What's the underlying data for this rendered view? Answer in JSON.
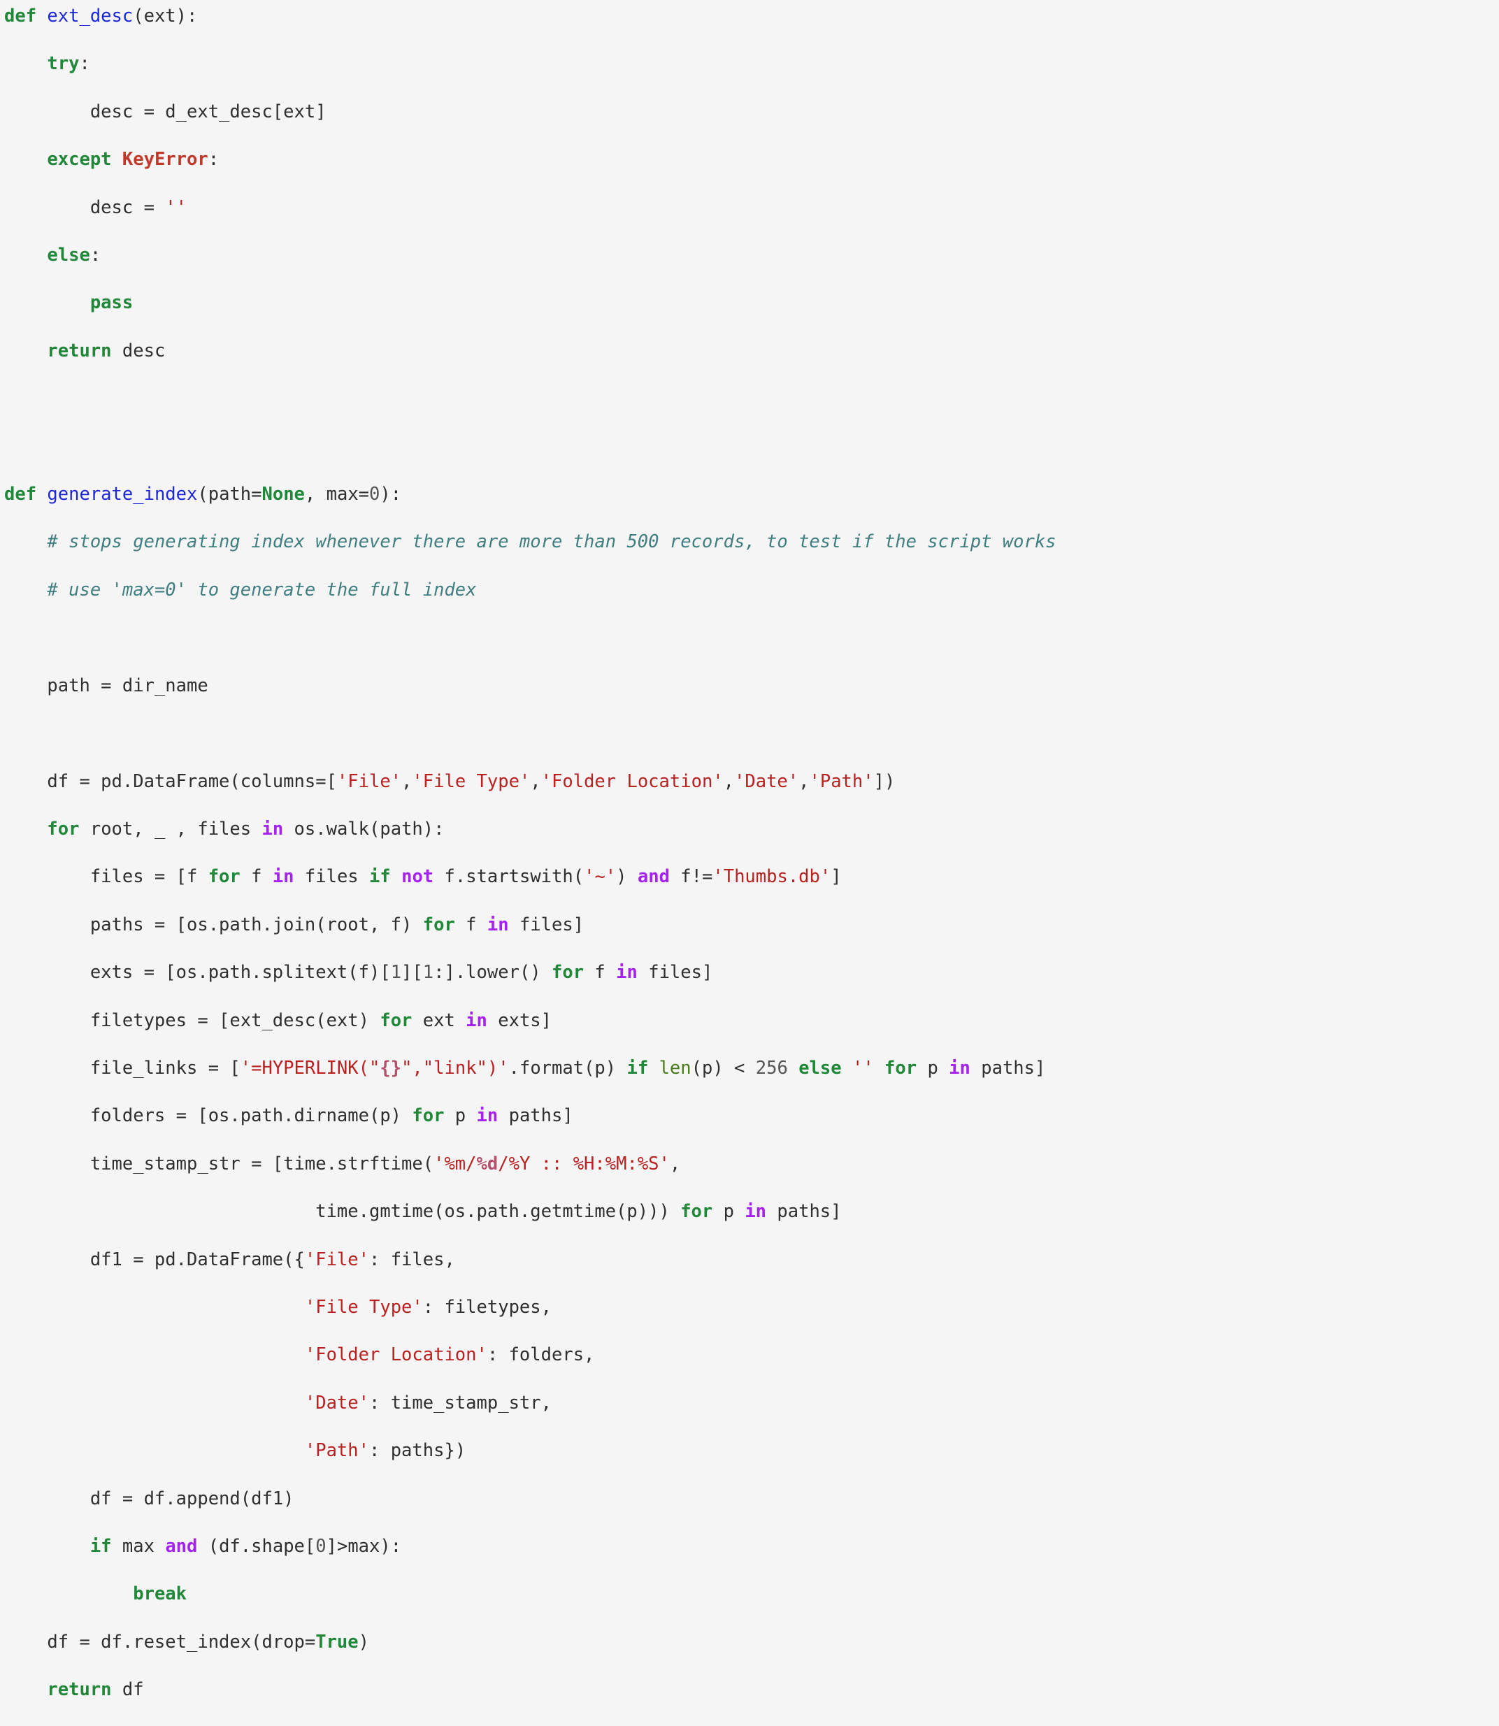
{
  "document": {
    "kind": "syntax-highlighted-python-source",
    "language": "Python",
    "background_color": "#f5f5f6",
    "default_text_color": "#2f2f2f"
  },
  "palette": {
    "keyword": "#218739",
    "keyword_constant": "#218739",
    "operator_word": "#a522f0",
    "function_name": "#1c28d8",
    "exception_name": "#c0392b",
    "builtin": "#4c7a1e",
    "string": "#ba2121",
    "string_format_spec": "#b6506b",
    "comment": "#417e80",
    "number": "#555555",
    "plain": "#2f2f2f"
  },
  "code": {
    "plain_text": "def ext_desc(ext):\n    try:\n        desc = d_ext_desc[ext]\n    except KeyError:\n        desc = ''\n    else:\n        pass\n    return desc\n\n\ndef generate_index(path=None, max=0):\n    # stops generating index whenever there are more than 500 records, to test if the script works\n    # use 'max=0' to generate the full index\n\n    path = dir_name\n\n    df = pd.DataFrame(columns=['File','File Type','Folder Location','Date','Path'])\n    for root, _ , files in os.walk(path):\n        files = [f for f in files if not f.startswith('~') and f!='Thumbs.db']\n        paths = [os.path.join(root, f) for f in files]\n        exts = [os.path.splitext(f)[1][1:].lower() for f in files]\n        filetypes = [ext_desc(ext) for ext in exts]\n        file_links = ['=HYPERLINK(\"{}\",\"link\")'.format(p) if len(p) < 256 else '' for p in paths]\n        folders = [os.path.dirname(p) for p in paths]\n        time_stamp_str = [time.strftime('%m/%d/%Y :: %H:%M:%S',\n                             time.gmtime(os.path.getmtime(p))) for p in paths]\n        df1 = pd.DataFrame({'File': files,\n                            'File Type': filetypes,\n                            'Folder Location': folders,\n                            'Date': time_stamp_str,\n                            'Path': paths})\n        df = df.append(df1)\n        if max and (df.shape[0]>max):\n            break\n    df = df.reset_index(drop=True)\n    return df",
    "lines": [
      {
        "n": 1,
        "tokens": [
          {
            "t": "def",
            "c": "k"
          },
          {
            "t": " ",
            "c": "w"
          },
          {
            "t": "ext_desc",
            "c": "nf"
          },
          {
            "t": "(ext):",
            "c": "p"
          }
        ]
      },
      {
        "n": 2,
        "tokens": [
          {
            "t": "    ",
            "c": "w"
          },
          {
            "t": "try",
            "c": "k"
          },
          {
            "t": ":",
            "c": "p"
          }
        ]
      },
      {
        "n": 3,
        "tokens": [
          {
            "t": "        desc = d_ext_desc[ext]",
            "c": "n"
          }
        ]
      },
      {
        "n": 4,
        "tokens": [
          {
            "t": "    ",
            "c": "w"
          },
          {
            "t": "except",
            "c": "k"
          },
          {
            "t": " ",
            "c": "w"
          },
          {
            "t": "KeyError",
            "c": "ne"
          },
          {
            "t": ":",
            "c": "p"
          }
        ]
      },
      {
        "n": 5,
        "tokens": [
          {
            "t": "        desc = ",
            "c": "n"
          },
          {
            "t": "''",
            "c": "s"
          }
        ]
      },
      {
        "n": 6,
        "tokens": [
          {
            "t": "    ",
            "c": "w"
          },
          {
            "t": "else",
            "c": "k"
          },
          {
            "t": ":",
            "c": "p"
          }
        ]
      },
      {
        "n": 7,
        "tokens": [
          {
            "t": "        ",
            "c": "w"
          },
          {
            "t": "pass",
            "c": "k"
          }
        ]
      },
      {
        "n": 8,
        "tokens": [
          {
            "t": "    ",
            "c": "w"
          },
          {
            "t": "return",
            "c": "k"
          },
          {
            "t": " desc",
            "c": "n"
          }
        ]
      },
      {
        "n": 9,
        "tokens": []
      },
      {
        "n": 10,
        "tokens": []
      },
      {
        "n": 11,
        "tokens": [
          {
            "t": "def",
            "c": "k"
          },
          {
            "t": " ",
            "c": "w"
          },
          {
            "t": "generate_index",
            "c": "nf"
          },
          {
            "t": "(path=",
            "c": "p"
          },
          {
            "t": "None",
            "c": "kc"
          },
          {
            "t": ", max=",
            "c": "p"
          },
          {
            "t": "0",
            "c": "m"
          },
          {
            "t": "):",
            "c": "p"
          }
        ]
      },
      {
        "n": 12,
        "tokens": [
          {
            "t": "    ",
            "c": "w"
          },
          {
            "t": "# stops generating index whenever there are more than 500 records, to test if the script works",
            "c": "c"
          }
        ]
      },
      {
        "n": 13,
        "tokens": [
          {
            "t": "    ",
            "c": "w"
          },
          {
            "t": "# use 'max=0' to generate the full index",
            "c": "c"
          }
        ]
      },
      {
        "n": 14,
        "tokens": []
      },
      {
        "n": 15,
        "tokens": [
          {
            "t": "    path = dir_name",
            "c": "n"
          }
        ]
      },
      {
        "n": 16,
        "tokens": []
      },
      {
        "n": 17,
        "tokens": [
          {
            "t": "    df = pd.DataFrame(columns=[",
            "c": "n"
          },
          {
            "t": "'File'",
            "c": "s"
          },
          {
            "t": ",",
            "c": "p"
          },
          {
            "t": "'File Type'",
            "c": "s"
          },
          {
            "t": ",",
            "c": "p"
          },
          {
            "t": "'Folder Location'",
            "c": "s"
          },
          {
            "t": ",",
            "c": "p"
          },
          {
            "t": "'Date'",
            "c": "s"
          },
          {
            "t": ",",
            "c": "p"
          },
          {
            "t": "'Path'",
            "c": "s"
          },
          {
            "t": "])",
            "c": "p"
          }
        ]
      },
      {
        "n": 18,
        "tokens": [
          {
            "t": "    ",
            "c": "w"
          },
          {
            "t": "for",
            "c": "k"
          },
          {
            "t": " root, _ , files ",
            "c": "n"
          },
          {
            "t": "in",
            "c": "ow"
          },
          {
            "t": " os.walk(path):",
            "c": "n"
          }
        ]
      },
      {
        "n": 19,
        "tokens": [
          {
            "t": "        files = [f ",
            "c": "n"
          },
          {
            "t": "for",
            "c": "k"
          },
          {
            "t": " f ",
            "c": "n"
          },
          {
            "t": "in",
            "c": "ow"
          },
          {
            "t": " files ",
            "c": "n"
          },
          {
            "t": "if",
            "c": "k"
          },
          {
            "t": " ",
            "c": "w"
          },
          {
            "t": "not",
            "c": "ow"
          },
          {
            "t": " f.startswith(",
            "c": "n"
          },
          {
            "t": "'~'",
            "c": "s"
          },
          {
            "t": ") ",
            "c": "p"
          },
          {
            "t": "and",
            "c": "ow"
          },
          {
            "t": " f!=",
            "c": "n"
          },
          {
            "t": "'Thumbs.db'",
            "c": "s"
          },
          {
            "t": "]",
            "c": "p"
          }
        ]
      },
      {
        "n": 20,
        "tokens": [
          {
            "t": "        paths = [os.path.join(root, f) ",
            "c": "n"
          },
          {
            "t": "for",
            "c": "k"
          },
          {
            "t": " f ",
            "c": "n"
          },
          {
            "t": "in",
            "c": "ow"
          },
          {
            "t": " files]",
            "c": "n"
          }
        ]
      },
      {
        "n": 21,
        "tokens": [
          {
            "t": "        exts = [os.path.splitext(f)[",
            "c": "n"
          },
          {
            "t": "1",
            "c": "m"
          },
          {
            "t": "][",
            "c": "p"
          },
          {
            "t": "1",
            "c": "m"
          },
          {
            "t": ":].lower() ",
            "c": "n"
          },
          {
            "t": "for",
            "c": "k"
          },
          {
            "t": " f ",
            "c": "n"
          },
          {
            "t": "in",
            "c": "ow"
          },
          {
            "t": " files]",
            "c": "n"
          }
        ]
      },
      {
        "n": 22,
        "tokens": [
          {
            "t": "        filetypes = [ext_desc(ext) ",
            "c": "n"
          },
          {
            "t": "for",
            "c": "k"
          },
          {
            "t": " ext ",
            "c": "n"
          },
          {
            "t": "in",
            "c": "ow"
          },
          {
            "t": " exts]",
            "c": "n"
          }
        ]
      },
      {
        "n": 23,
        "tokens": [
          {
            "t": "        file_links = [",
            "c": "n"
          },
          {
            "t": "'=HYPERLINK(\"",
            "c": "s"
          },
          {
            "t": "{}",
            "c": "si"
          },
          {
            "t": "\",\"link\")'",
            "c": "s"
          },
          {
            "t": ".format(p) ",
            "c": "n"
          },
          {
            "t": "if",
            "c": "k"
          },
          {
            "t": " ",
            "c": "w"
          },
          {
            "t": "len",
            "c": "nb"
          },
          {
            "t": "(p) < ",
            "c": "n"
          },
          {
            "t": "256",
            "c": "m"
          },
          {
            "t": " ",
            "c": "w"
          },
          {
            "t": "else",
            "c": "k"
          },
          {
            "t": " ",
            "c": "w"
          },
          {
            "t": "''",
            "c": "s"
          },
          {
            "t": " ",
            "c": "w"
          },
          {
            "t": "for",
            "c": "k"
          },
          {
            "t": " p ",
            "c": "n"
          },
          {
            "t": "in",
            "c": "ow"
          },
          {
            "t": " paths]",
            "c": "n"
          }
        ]
      },
      {
        "n": 24,
        "tokens": [
          {
            "t": "        folders = [os.path.dirname(p) ",
            "c": "n"
          },
          {
            "t": "for",
            "c": "k"
          },
          {
            "t": " p ",
            "c": "n"
          },
          {
            "t": "in",
            "c": "ow"
          },
          {
            "t": " paths]",
            "c": "n"
          }
        ]
      },
      {
        "n": 25,
        "tokens": [
          {
            "t": "        time_stamp_str = [time.strftime(",
            "c": "n"
          },
          {
            "t": "'",
            "c": "s"
          },
          {
            "t": "%m/",
            "c": "s"
          },
          {
            "t": "%d",
            "c": "si"
          },
          {
            "t": "/%Y :: %H:%M:%S'",
            "c": "s"
          },
          {
            "t": ",",
            "c": "p"
          }
        ]
      },
      {
        "n": 26,
        "tokens": [
          {
            "t": "                             time.gmtime(os.path.getmtime(p))) ",
            "c": "n"
          },
          {
            "t": "for",
            "c": "k"
          },
          {
            "t": " p ",
            "c": "n"
          },
          {
            "t": "in",
            "c": "ow"
          },
          {
            "t": " paths]",
            "c": "n"
          }
        ]
      },
      {
        "n": 27,
        "tokens": [
          {
            "t": "        df1 = pd.DataFrame({",
            "c": "n"
          },
          {
            "t": "'File'",
            "c": "s"
          },
          {
            "t": ": files,",
            "c": "n"
          }
        ]
      },
      {
        "n": 28,
        "tokens": [
          {
            "t": "                            ",
            "c": "w"
          },
          {
            "t": "'File Type'",
            "c": "s"
          },
          {
            "t": ": filetypes,",
            "c": "n"
          }
        ]
      },
      {
        "n": 29,
        "tokens": [
          {
            "t": "                            ",
            "c": "w"
          },
          {
            "t": "'Folder Location'",
            "c": "s"
          },
          {
            "t": ": folders,",
            "c": "n"
          }
        ]
      },
      {
        "n": 30,
        "tokens": [
          {
            "t": "                            ",
            "c": "w"
          },
          {
            "t": "'Date'",
            "c": "s"
          },
          {
            "t": ": time_stamp_str,",
            "c": "n"
          }
        ]
      },
      {
        "n": 31,
        "tokens": [
          {
            "t": "                            ",
            "c": "w"
          },
          {
            "t": "'Path'",
            "c": "s"
          },
          {
            "t": ": paths})",
            "c": "n"
          }
        ]
      },
      {
        "n": 32,
        "tokens": [
          {
            "t": "        df = df.append(df1)",
            "c": "n"
          }
        ]
      },
      {
        "n": 33,
        "tokens": [
          {
            "t": "        ",
            "c": "w"
          },
          {
            "t": "if",
            "c": "k"
          },
          {
            "t": " max ",
            "c": "n"
          },
          {
            "t": "and",
            "c": "ow"
          },
          {
            "t": " (df.shape[",
            "c": "n"
          },
          {
            "t": "0",
            "c": "m"
          },
          {
            "t": "]>max):",
            "c": "n"
          }
        ]
      },
      {
        "n": 34,
        "tokens": [
          {
            "t": "            ",
            "c": "w"
          },
          {
            "t": "break",
            "c": "k"
          }
        ]
      },
      {
        "n": 35,
        "tokens": [
          {
            "t": "    df = df.reset_index(drop=",
            "c": "n"
          },
          {
            "t": "True",
            "c": "kc"
          },
          {
            "t": ")",
            "c": "p"
          }
        ]
      },
      {
        "n": 36,
        "tokens": [
          {
            "t": "    ",
            "c": "w"
          },
          {
            "t": "return",
            "c": "k"
          },
          {
            "t": " df",
            "c": "n"
          }
        ]
      }
    ]
  }
}
